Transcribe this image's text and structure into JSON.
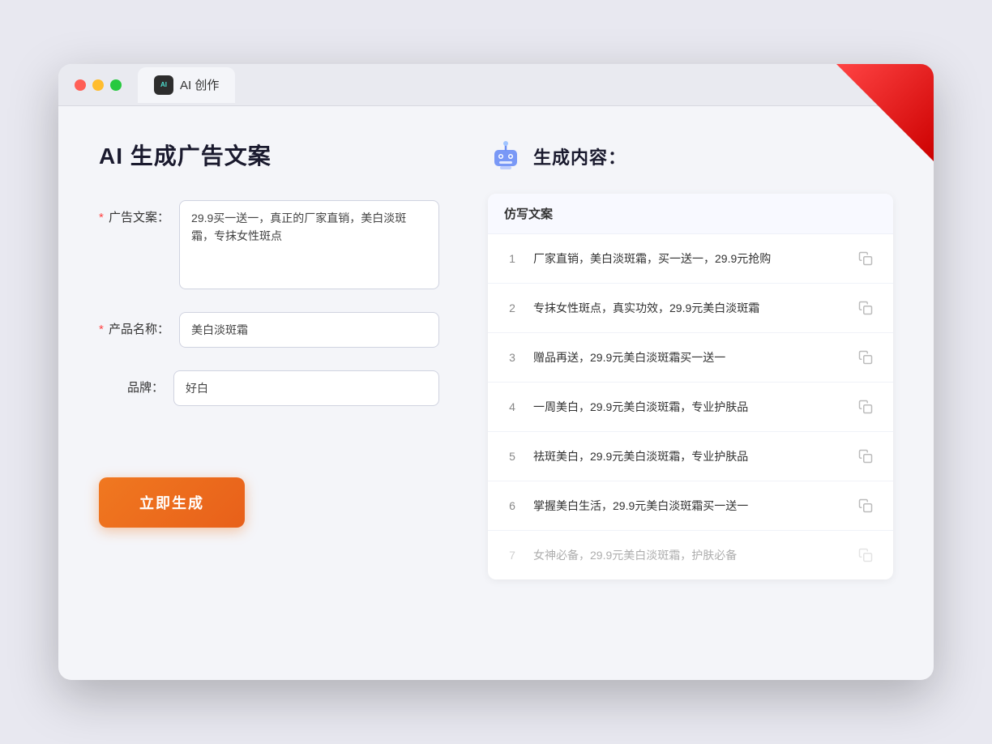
{
  "browser": {
    "tab_label": "AI 创作"
  },
  "page": {
    "title": "AI 生成广告文案",
    "result_header": "生成内容："
  },
  "form": {
    "ad_copy_label": "广告文案：",
    "ad_copy_required": true,
    "ad_copy_value": "29.9买一送一，真正的厂家直销，美白淡斑霜，专抹女性斑点",
    "product_name_label": "产品名称：",
    "product_name_required": true,
    "product_name_value": "美白淡斑霜",
    "brand_label": "品牌：",
    "brand_required": false,
    "brand_value": "好白",
    "generate_button": "立即生成"
  },
  "results": {
    "table_header": "仿写文案",
    "items": [
      {
        "id": 1,
        "text": "厂家直销，美白淡斑霜，买一送一，29.9元抢购",
        "faded": false
      },
      {
        "id": 2,
        "text": "专抹女性斑点，真实功效，29.9元美白淡斑霜",
        "faded": false
      },
      {
        "id": 3,
        "text": "赠品再送，29.9元美白淡斑霜买一送一",
        "faded": false
      },
      {
        "id": 4,
        "text": "一周美白，29.9元美白淡斑霜，专业护肤品",
        "faded": false
      },
      {
        "id": 5,
        "text": "祛斑美白，29.9元美白淡斑霜，专业护肤品",
        "faded": false
      },
      {
        "id": 6,
        "text": "掌握美白生活，29.9元美白淡斑霜买一送一",
        "faded": false
      },
      {
        "id": 7,
        "text": "女神必备，29.9元美白淡斑霜，护肤必备",
        "faded": true
      }
    ]
  }
}
